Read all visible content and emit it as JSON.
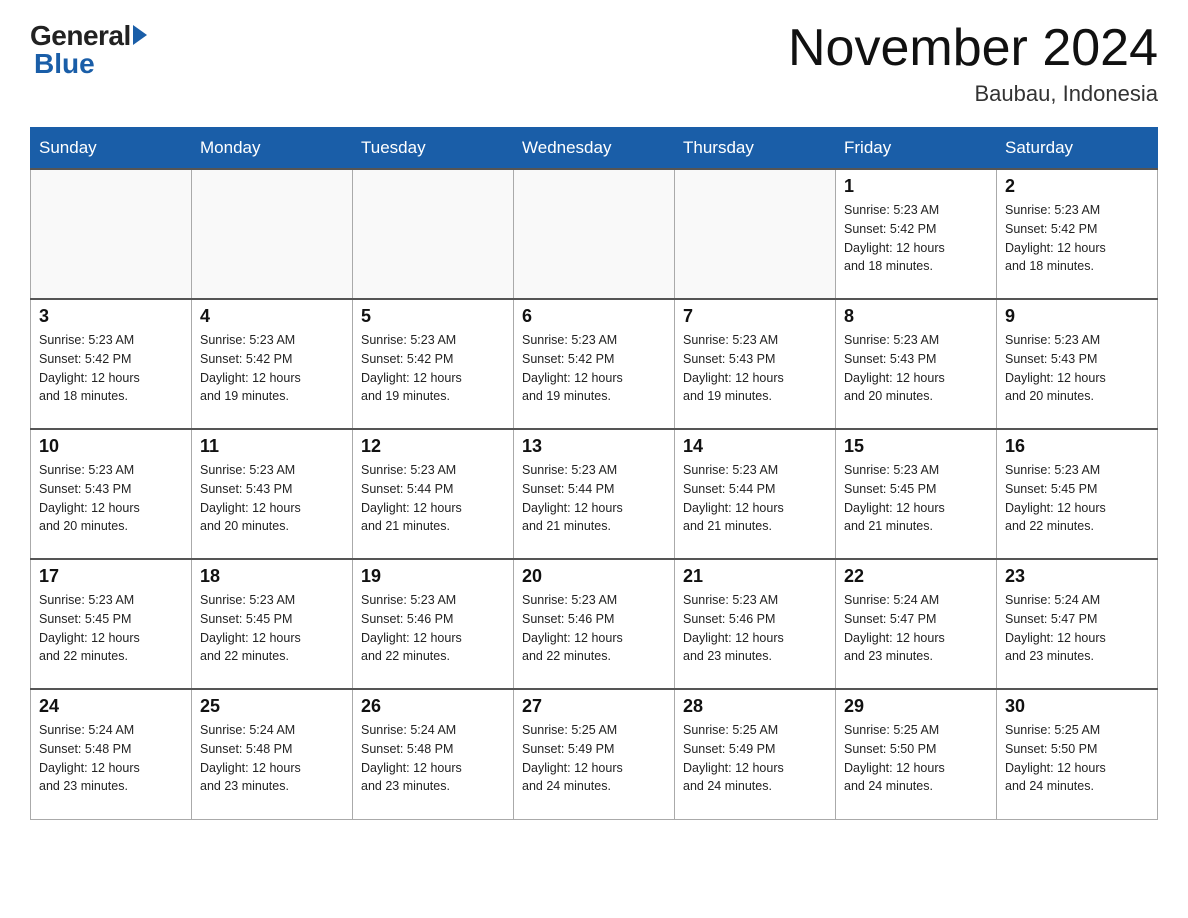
{
  "header": {
    "logo_general": "General",
    "logo_blue": "Blue",
    "title": "November 2024",
    "location": "Baubau, Indonesia"
  },
  "weekdays": [
    "Sunday",
    "Monday",
    "Tuesday",
    "Wednesday",
    "Thursday",
    "Friday",
    "Saturday"
  ],
  "weeks": [
    [
      {
        "day": "",
        "info": ""
      },
      {
        "day": "",
        "info": ""
      },
      {
        "day": "",
        "info": ""
      },
      {
        "day": "",
        "info": ""
      },
      {
        "day": "",
        "info": ""
      },
      {
        "day": "1",
        "info": "Sunrise: 5:23 AM\nSunset: 5:42 PM\nDaylight: 12 hours\nand 18 minutes."
      },
      {
        "day": "2",
        "info": "Sunrise: 5:23 AM\nSunset: 5:42 PM\nDaylight: 12 hours\nand 18 minutes."
      }
    ],
    [
      {
        "day": "3",
        "info": "Sunrise: 5:23 AM\nSunset: 5:42 PM\nDaylight: 12 hours\nand 18 minutes."
      },
      {
        "day": "4",
        "info": "Sunrise: 5:23 AM\nSunset: 5:42 PM\nDaylight: 12 hours\nand 19 minutes."
      },
      {
        "day": "5",
        "info": "Sunrise: 5:23 AM\nSunset: 5:42 PM\nDaylight: 12 hours\nand 19 minutes."
      },
      {
        "day": "6",
        "info": "Sunrise: 5:23 AM\nSunset: 5:42 PM\nDaylight: 12 hours\nand 19 minutes."
      },
      {
        "day": "7",
        "info": "Sunrise: 5:23 AM\nSunset: 5:43 PM\nDaylight: 12 hours\nand 19 minutes."
      },
      {
        "day": "8",
        "info": "Sunrise: 5:23 AM\nSunset: 5:43 PM\nDaylight: 12 hours\nand 20 minutes."
      },
      {
        "day": "9",
        "info": "Sunrise: 5:23 AM\nSunset: 5:43 PM\nDaylight: 12 hours\nand 20 minutes."
      }
    ],
    [
      {
        "day": "10",
        "info": "Sunrise: 5:23 AM\nSunset: 5:43 PM\nDaylight: 12 hours\nand 20 minutes."
      },
      {
        "day": "11",
        "info": "Sunrise: 5:23 AM\nSunset: 5:43 PM\nDaylight: 12 hours\nand 20 minutes."
      },
      {
        "day": "12",
        "info": "Sunrise: 5:23 AM\nSunset: 5:44 PM\nDaylight: 12 hours\nand 21 minutes."
      },
      {
        "day": "13",
        "info": "Sunrise: 5:23 AM\nSunset: 5:44 PM\nDaylight: 12 hours\nand 21 minutes."
      },
      {
        "day": "14",
        "info": "Sunrise: 5:23 AM\nSunset: 5:44 PM\nDaylight: 12 hours\nand 21 minutes."
      },
      {
        "day": "15",
        "info": "Sunrise: 5:23 AM\nSunset: 5:45 PM\nDaylight: 12 hours\nand 21 minutes."
      },
      {
        "day": "16",
        "info": "Sunrise: 5:23 AM\nSunset: 5:45 PM\nDaylight: 12 hours\nand 22 minutes."
      }
    ],
    [
      {
        "day": "17",
        "info": "Sunrise: 5:23 AM\nSunset: 5:45 PM\nDaylight: 12 hours\nand 22 minutes."
      },
      {
        "day": "18",
        "info": "Sunrise: 5:23 AM\nSunset: 5:45 PM\nDaylight: 12 hours\nand 22 minutes."
      },
      {
        "day": "19",
        "info": "Sunrise: 5:23 AM\nSunset: 5:46 PM\nDaylight: 12 hours\nand 22 minutes."
      },
      {
        "day": "20",
        "info": "Sunrise: 5:23 AM\nSunset: 5:46 PM\nDaylight: 12 hours\nand 22 minutes."
      },
      {
        "day": "21",
        "info": "Sunrise: 5:23 AM\nSunset: 5:46 PM\nDaylight: 12 hours\nand 23 minutes."
      },
      {
        "day": "22",
        "info": "Sunrise: 5:24 AM\nSunset: 5:47 PM\nDaylight: 12 hours\nand 23 minutes."
      },
      {
        "day": "23",
        "info": "Sunrise: 5:24 AM\nSunset: 5:47 PM\nDaylight: 12 hours\nand 23 minutes."
      }
    ],
    [
      {
        "day": "24",
        "info": "Sunrise: 5:24 AM\nSunset: 5:48 PM\nDaylight: 12 hours\nand 23 minutes."
      },
      {
        "day": "25",
        "info": "Sunrise: 5:24 AM\nSunset: 5:48 PM\nDaylight: 12 hours\nand 23 minutes."
      },
      {
        "day": "26",
        "info": "Sunrise: 5:24 AM\nSunset: 5:48 PM\nDaylight: 12 hours\nand 23 minutes."
      },
      {
        "day": "27",
        "info": "Sunrise: 5:25 AM\nSunset: 5:49 PM\nDaylight: 12 hours\nand 24 minutes."
      },
      {
        "day": "28",
        "info": "Sunrise: 5:25 AM\nSunset: 5:49 PM\nDaylight: 12 hours\nand 24 minutes."
      },
      {
        "day": "29",
        "info": "Sunrise: 5:25 AM\nSunset: 5:50 PM\nDaylight: 12 hours\nand 24 minutes."
      },
      {
        "day": "30",
        "info": "Sunrise: 5:25 AM\nSunset: 5:50 PM\nDaylight: 12 hours\nand 24 minutes."
      }
    ]
  ]
}
